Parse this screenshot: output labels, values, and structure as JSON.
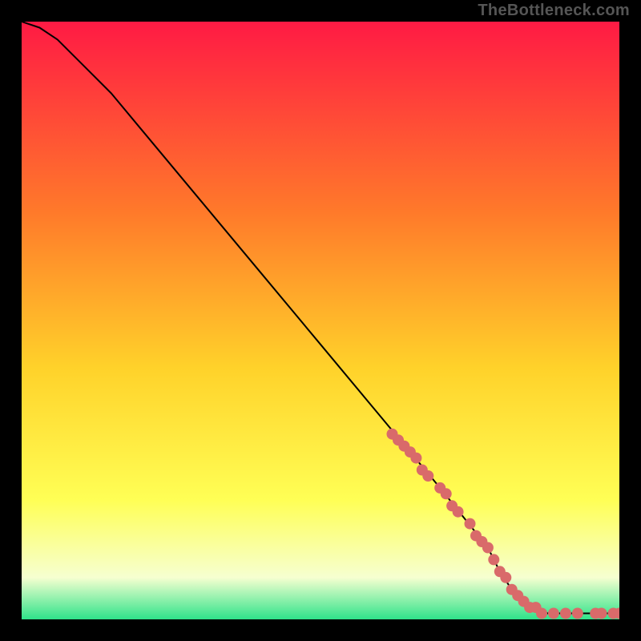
{
  "watermark": "TheBottleneck.com",
  "colors": {
    "gradient_top": "#ff1a44",
    "gradient_mid_upper": "#ff7a2a",
    "gradient_mid": "#ffd22a",
    "gradient_mid_lower": "#ffff55",
    "gradient_lower": "#f6ffd0",
    "gradient_bottom": "#2fe38a",
    "curve": "#000000",
    "marker": "#d96a6a",
    "frame": "#000000"
  },
  "chart_data": {
    "type": "line",
    "title": "",
    "xlabel": "",
    "ylabel": "",
    "xlim": [
      0,
      100
    ],
    "ylim": [
      0,
      100
    ],
    "series": [
      {
        "name": "bottleneck-curve",
        "x": [
          0,
          3,
          6,
          10,
          15,
          20,
          30,
          40,
          50,
          60,
          70,
          78,
          80,
          82,
          85,
          88,
          92,
          96,
          100
        ],
        "y": [
          100,
          99,
          97,
          93,
          88,
          82,
          70,
          58,
          46,
          34,
          22,
          12,
          8,
          5,
          2,
          1,
          1,
          1,
          1
        ]
      }
    ],
    "markers": {
      "name": "highlighted-points",
      "x": [
        62,
        63,
        64,
        65,
        66,
        67,
        68,
        70,
        71,
        72,
        73,
        75,
        76,
        77,
        78,
        79,
        80,
        81,
        82,
        83,
        84,
        85,
        86,
        87,
        89,
        91,
        93,
        96,
        97,
        99,
        100
      ],
      "y": [
        31,
        30,
        29,
        28,
        27,
        25,
        24,
        22,
        21,
        19,
        18,
        16,
        14,
        13,
        12,
        10,
        8,
        7,
        5,
        4,
        3,
        2,
        2,
        1,
        1,
        1,
        1,
        1,
        1,
        1,
        1
      ]
    }
  }
}
